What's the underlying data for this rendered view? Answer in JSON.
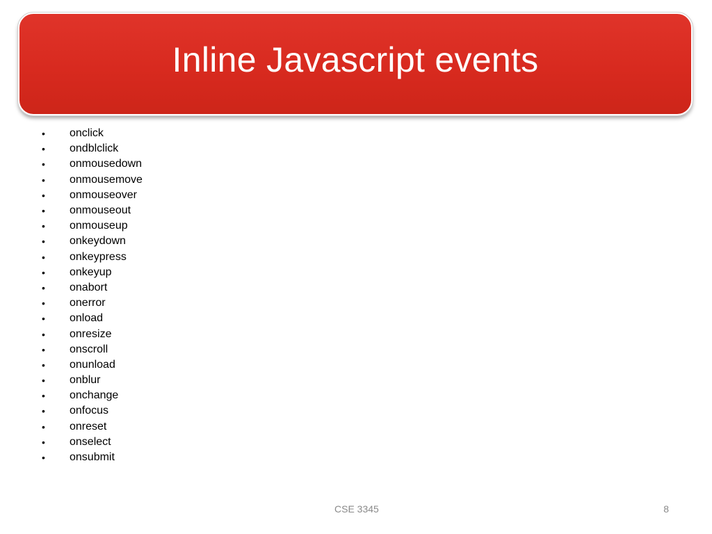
{
  "slide": {
    "title": "Inline Javascript events",
    "bullet_symbol": "•",
    "events": [
      "onclick",
      "ondblclick",
      "onmousedown",
      "onmousemove",
      "onmouseover",
      "onmouseout",
      "onmouseup",
      "onkeydown",
      "onkeypress",
      "onkeyup",
      "onabort",
      "onerror",
      "onload",
      "onresize",
      "onscroll",
      "onunload",
      "onblur",
      "onchange",
      "onfocus",
      "onreset",
      "onselect",
      "onsubmit"
    ]
  },
  "footer": {
    "course": "CSE 3345",
    "page_number": "8"
  },
  "colors": {
    "banner": "#d82a1f",
    "title_text": "#ffffff",
    "footer_text": "#8a8a8a"
  }
}
